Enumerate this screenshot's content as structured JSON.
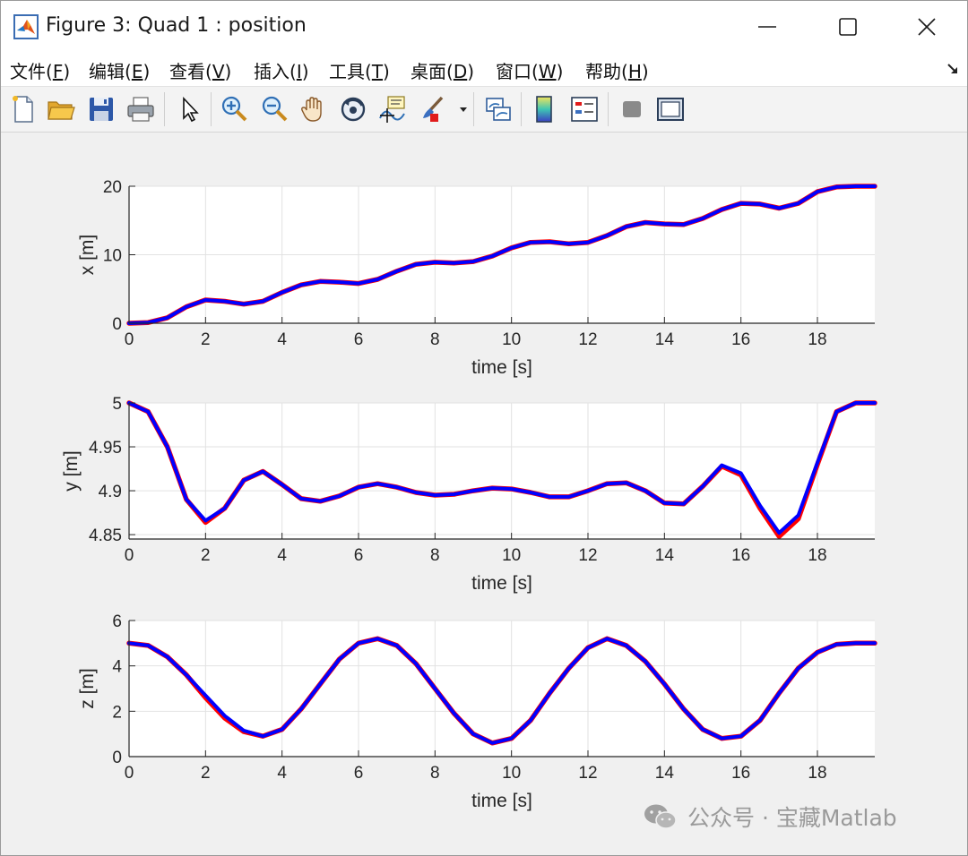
{
  "window": {
    "title": "Figure 3: Quad 1 : position"
  },
  "menu": [
    {
      "label": "文件",
      "mnemonic": "F"
    },
    {
      "label": "编辑",
      "mnemonic": "E"
    },
    {
      "label": "查看",
      "mnemonic": "V"
    },
    {
      "label": "插入",
      "mnemonic": "I"
    },
    {
      "label": "工具",
      "mnemonic": "T"
    },
    {
      "label": "桌面",
      "mnemonic": "D"
    },
    {
      "label": "窗口",
      "mnemonic": "W"
    },
    {
      "label": "帮助",
      "mnemonic": "H"
    }
  ],
  "toolbar": [
    {
      "icon": "new-figure-icon"
    },
    {
      "icon": "open-file-icon"
    },
    {
      "icon": "save-icon"
    },
    {
      "icon": "print-icon"
    },
    {
      "icon": "edit-plot-arrow-icon"
    },
    {
      "icon": "zoom-in-icon"
    },
    {
      "icon": "zoom-out-icon"
    },
    {
      "icon": "pan-hand-icon"
    },
    {
      "icon": "rotate-3d-icon"
    },
    {
      "icon": "data-cursor-icon"
    },
    {
      "icon": "brush-icon"
    },
    {
      "icon": "link-plot-icon"
    },
    {
      "icon": "colorbar-icon"
    },
    {
      "icon": "legend-icon"
    },
    {
      "icon": "hide-plot-tools-icon"
    },
    {
      "icon": "show-plot-tools-icon"
    }
  ],
  "colors": {
    "series_blue": "#0000ff",
    "series_red": "#ff0000",
    "grid": "#e2e2e2",
    "axes_bg": "#ffffff",
    "figure_bg": "#f0f0f0"
  },
  "watermark": {
    "text": "公众号 · 宝藏Matlab"
  },
  "chart_data": [
    {
      "type": "line",
      "title": "",
      "xlabel": "time [s]",
      "ylabel": "x [m]",
      "xlim": [
        0,
        19.5
      ],
      "ylim": [
        0,
        20
      ],
      "xticks": [
        0,
        2,
        4,
        6,
        8,
        10,
        12,
        14,
        16,
        18
      ],
      "yticks": [
        0,
        10,
        20
      ],
      "ytick_labels": [
        "0",
        "10",
        "20"
      ],
      "grid": true,
      "series": [
        {
          "color": "#ff0000",
          "x": [
            0,
            0.5,
            1,
            1.5,
            2,
            2.5,
            3,
            3.5,
            4,
            4.5,
            5,
            5.5,
            6,
            6.5,
            7,
            7.5,
            8,
            8.5,
            9,
            9.5,
            10,
            10.5,
            11,
            11.5,
            12,
            12.5,
            13,
            13.5,
            14,
            14.5,
            15,
            15.5,
            16,
            16.5,
            17,
            17.5,
            18,
            18.5,
            19,
            19.5
          ],
          "y": [
            0,
            0.1,
            0.8,
            2.4,
            3.4,
            3.2,
            2.8,
            3.2,
            4.5,
            5.6,
            6.1,
            6.0,
            5.8,
            6.4,
            7.6,
            8.6,
            8.9,
            8.8,
            9.0,
            9.8,
            11.0,
            11.8,
            11.9,
            11.6,
            11.8,
            12.8,
            14.1,
            14.7,
            14.5,
            14.4,
            15.3,
            16.6,
            17.5,
            17.4,
            16.8,
            17.5,
            19.2,
            19.9,
            20.0,
            20.0
          ]
        },
        {
          "color": "#0000ff",
          "x": [
            0,
            0.5,
            1,
            1.5,
            2,
            2.5,
            3,
            3.5,
            4,
            4.5,
            5,
            5.5,
            6,
            6.5,
            7,
            7.5,
            8,
            8.5,
            9,
            9.5,
            10,
            10.5,
            11,
            11.5,
            12,
            12.5,
            13,
            13.5,
            14,
            14.5,
            15,
            15.5,
            16,
            16.5,
            17,
            17.5,
            18,
            18.5,
            19,
            19.5
          ],
          "y": [
            0,
            0.1,
            0.8,
            2.4,
            3.4,
            3.2,
            2.8,
            3.2,
            4.5,
            5.6,
            6.1,
            6.0,
            5.8,
            6.4,
            7.6,
            8.6,
            8.9,
            8.8,
            9.0,
            9.8,
            11.0,
            11.8,
            11.9,
            11.6,
            11.8,
            12.8,
            14.1,
            14.7,
            14.5,
            14.4,
            15.3,
            16.6,
            17.5,
            17.4,
            16.8,
            17.5,
            19.2,
            19.9,
            20.0,
            20.0
          ]
        }
      ]
    },
    {
      "type": "line",
      "title": "",
      "xlabel": "time [s]",
      "ylabel": "y [m]",
      "xlim": [
        0,
        19.5
      ],
      "ylim": [
        4.845,
        5.0
      ],
      "xticks": [
        0,
        2,
        4,
        6,
        8,
        10,
        12,
        14,
        16,
        18
      ],
      "yticks": [
        4.85,
        4.9,
        4.95,
        5.0
      ],
      "ytick_labels": [
        "4.85",
        "4.9",
        "4.95",
        "5"
      ],
      "grid": true,
      "series": [
        {
          "color": "#ff0000",
          "x": [
            0,
            0.5,
            1,
            1.5,
            2,
            2.5,
            3,
            3.5,
            4,
            4.5,
            5,
            5.5,
            6,
            6.5,
            7,
            7.5,
            8,
            8.5,
            9,
            9.5,
            10,
            10.5,
            11,
            11.5,
            12,
            12.5,
            13,
            13.5,
            14,
            14.5,
            15,
            15.5,
            16,
            16.5,
            17,
            17.5,
            18,
            18.5,
            19,
            19.5
          ],
          "y": [
            5.0,
            4.99,
            4.95,
            4.89,
            4.864,
            4.88,
            4.912,
            4.922,
            4.907,
            4.891,
            4.888,
            4.894,
            4.904,
            4.908,
            4.904,
            4.898,
            4.895,
            4.896,
            4.9,
            4.903,
            4.902,
            4.898,
            4.893,
            4.893,
            4.9,
            4.908,
            4.909,
            4.9,
            4.886,
            4.885,
            4.905,
            4.928,
            4.918,
            4.88,
            4.848,
            4.868,
            4.93,
            4.99,
            5.0,
            5.0
          ]
        },
        {
          "color": "#0000ff",
          "x": [
            0,
            0.5,
            1,
            1.5,
            2,
            2.5,
            3,
            3.5,
            4,
            4.5,
            5,
            5.5,
            6,
            6.5,
            7,
            7.5,
            8,
            8.5,
            9,
            9.5,
            10,
            10.5,
            11,
            11.5,
            12,
            12.5,
            13,
            13.5,
            14,
            14.5,
            15,
            15.5,
            16,
            16.5,
            17,
            17.5,
            18,
            18.5,
            19,
            19.5
          ],
          "y": [
            5.0,
            4.99,
            4.95,
            4.89,
            4.866,
            4.88,
            4.912,
            4.922,
            4.907,
            4.891,
            4.888,
            4.894,
            4.904,
            4.908,
            4.904,
            4.898,
            4.895,
            4.896,
            4.9,
            4.903,
            4.902,
            4.898,
            4.893,
            4.893,
            4.9,
            4.908,
            4.909,
            4.9,
            4.886,
            4.885,
            4.905,
            4.929,
            4.92,
            4.883,
            4.852,
            4.872,
            4.932,
            4.99,
            5.0,
            5.0
          ]
        }
      ]
    },
    {
      "type": "line",
      "title": "",
      "xlabel": "time [s]",
      "ylabel": "z [m]",
      "xlim": [
        0,
        19.5
      ],
      "ylim": [
        0,
        6
      ],
      "xticks": [
        0,
        2,
        4,
        6,
        8,
        10,
        12,
        14,
        16,
        18
      ],
      "yticks": [
        0,
        2,
        4,
        6
      ],
      "ytick_labels": [
        "0",
        "2",
        "4",
        "6"
      ],
      "grid": true,
      "series": [
        {
          "color": "#ff0000",
          "x": [
            0,
            0.5,
            1,
            1.5,
            2,
            2.5,
            3,
            3.5,
            4,
            4.5,
            5,
            5.5,
            6,
            6.5,
            7,
            7.5,
            8,
            8.5,
            9,
            9.5,
            10,
            10.5,
            11,
            11.5,
            12,
            12.5,
            13,
            13.5,
            14,
            14.5,
            15,
            15.5,
            16,
            16.5,
            17,
            17.5,
            18,
            18.5,
            19,
            19.5
          ],
          "y": [
            5.0,
            4.9,
            4.4,
            3.6,
            2.6,
            1.7,
            1.1,
            0.9,
            1.2,
            2.1,
            3.2,
            4.3,
            5.0,
            5.2,
            4.9,
            4.1,
            3.0,
            1.9,
            1.0,
            0.6,
            0.8,
            1.6,
            2.8,
            3.9,
            4.8,
            5.2,
            4.9,
            4.2,
            3.2,
            2.1,
            1.2,
            0.8,
            0.9,
            1.6,
            2.8,
            3.9,
            4.6,
            4.95,
            5.0,
            5.0
          ]
        },
        {
          "color": "#0000ff",
          "x": [
            0,
            0.5,
            1,
            1.5,
            2,
            2.5,
            3,
            3.5,
            4,
            4.5,
            5,
            5.5,
            6,
            6.5,
            7,
            7.5,
            8,
            8.5,
            9,
            9.5,
            10,
            10.5,
            11,
            11.5,
            12,
            12.5,
            13,
            13.5,
            14,
            14.5,
            15,
            15.5,
            16,
            16.5,
            17,
            17.5,
            18,
            18.5,
            19,
            19.5
          ],
          "y": [
            5.0,
            4.9,
            4.4,
            3.6,
            2.7,
            1.8,
            1.15,
            0.9,
            1.2,
            2.1,
            3.2,
            4.3,
            5.0,
            5.2,
            4.9,
            4.1,
            3.0,
            1.9,
            1.0,
            0.6,
            0.8,
            1.6,
            2.8,
            3.9,
            4.8,
            5.2,
            4.9,
            4.2,
            3.2,
            2.1,
            1.2,
            0.8,
            0.9,
            1.6,
            2.8,
            3.9,
            4.6,
            4.95,
            5.0,
            5.0
          ]
        }
      ]
    }
  ]
}
